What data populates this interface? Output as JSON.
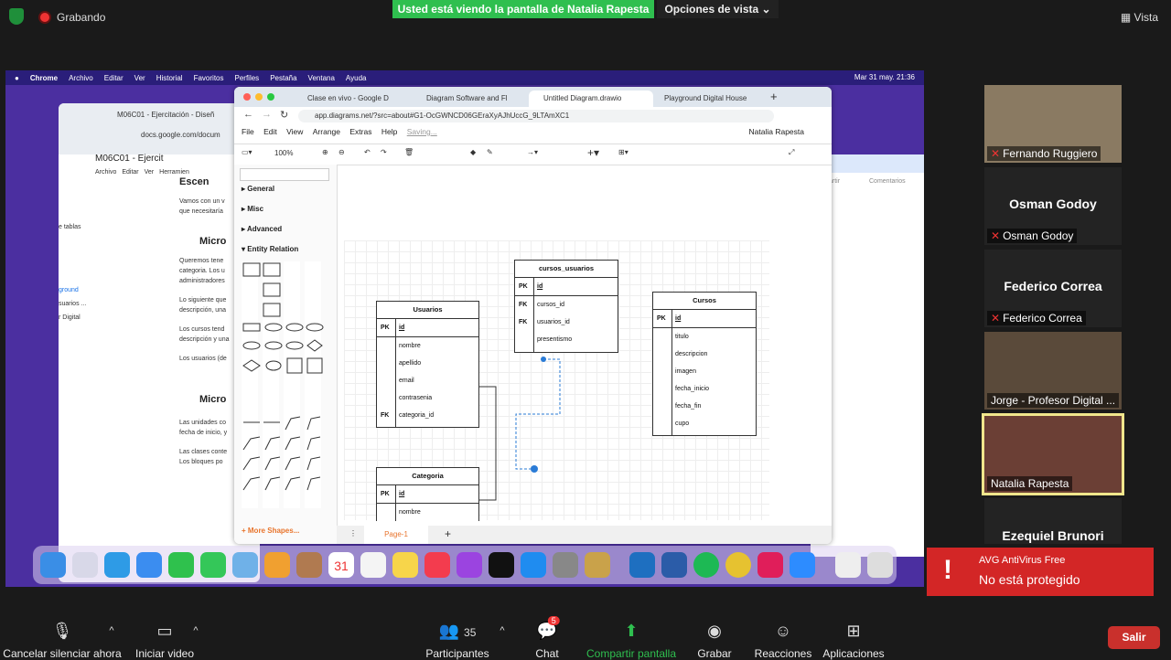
{
  "zoom": {
    "recording_label": "Grabando",
    "share_banner": "Usted está viendo la pantalla de Natalia Rapesta",
    "share_options": "Opciones de vista",
    "view_label": "Vista"
  },
  "mac": {
    "menu": [
      "Chrome",
      "Archivo",
      "Editar",
      "Ver",
      "Historial",
      "Favoritos",
      "Perfiles",
      "Pestaña",
      "Ventana",
      "Ayuda"
    ],
    "datetime": "Mar 31 may.  21:36"
  },
  "gdoc": {
    "tab_title": "M06C01 - Ejercitación - Diseñ",
    "url": "docs.google.com/docum",
    "doc_title": "M06C01 - Ejercit",
    "menu": [
      "Archivo",
      "Editar",
      "Ver",
      "Herramien"
    ],
    "heading": "Escen",
    "side_items": [
      "e tablas",
      "ground",
      "suarios ...",
      "r Digital"
    ],
    "paragraphs": [
      "Vamos con un v",
      "que necesitaría",
      "Micro",
      "Queremos tene",
      "categoria. Los u",
      "administradores",
      "Lo siguiente que",
      "descripción, una",
      "Los cursos tend",
      "descripción y una",
      "Los usuarios (de",
      "Micro",
      "Las unidades co",
      "fecha de inicio, y",
      "Las clases conte",
      "Los bloques po"
    ]
  },
  "drawio": {
    "tabs": [
      "Clase en vivo - Google D",
      "Diagram Software and Fl",
      "Untitled Diagram.drawio",
      "Playground Digital House"
    ],
    "url": "app.diagrams.net/?src=about#G1-OcGWNCD06GEraXyAJhUccG_9LTAmXC1",
    "menu": [
      "File",
      "Edit",
      "View",
      "Arrange",
      "Extras",
      "Help"
    ],
    "saving": "Saving...",
    "user": "Natalia Rapesta",
    "zoom": "100%",
    "sidebar_sections": [
      "General",
      "Misc",
      "Advanced",
      "Entity Relation"
    ],
    "more_shapes": "+ More Shapes...",
    "page_tab": "Page-1",
    "right_toolbar": [
      "artir",
      "Comentarios"
    ],
    "entities": {
      "usuarios": {
        "title": "Usuarios",
        "rows": [
          {
            "k": "PK",
            "f": "id"
          },
          {
            "k": "",
            "f": "nombre"
          },
          {
            "k": "",
            "f": "apellido"
          },
          {
            "k": "",
            "f": "email"
          },
          {
            "k": "",
            "f": "contrasenia"
          },
          {
            "k": "FK",
            "f": "categoria_id"
          }
        ]
      },
      "cursos_usuarios": {
        "title": "cursos_usuarios",
        "rows": [
          {
            "k": "PK",
            "f": "id"
          },
          {
            "k": "FK",
            "f": "cursos_id"
          },
          {
            "k": "FK",
            "f": "usuarios_id"
          },
          {
            "k": "",
            "f": "presentismo"
          }
        ]
      },
      "cursos": {
        "title": "Cursos",
        "rows": [
          {
            "k": "PK",
            "f": "id"
          },
          {
            "k": "",
            "f": "titulo"
          },
          {
            "k": "",
            "f": "descripcion"
          },
          {
            "k": "",
            "f": "imagen"
          },
          {
            "k": "",
            "f": "fecha_inicio"
          },
          {
            "k": "",
            "f": "fecha_fin"
          },
          {
            "k": "",
            "f": "cupo"
          }
        ]
      },
      "categoria": {
        "title": "Categoria",
        "rows": [
          {
            "k": "PK",
            "f": "id"
          },
          {
            "k": "",
            "f": "nombre"
          }
        ]
      }
    }
  },
  "participants": [
    {
      "name": "Fernando Ruggiero",
      "muted": true,
      "video": true
    },
    {
      "name": "Osman Godoy",
      "muted": true,
      "video": false
    },
    {
      "name": "Federico Correa",
      "muted": true,
      "video": false
    },
    {
      "name": "Jorge - Profesor Digital ...",
      "muted": false,
      "video": true
    },
    {
      "name": "Natalia Rapesta",
      "muted": false,
      "video": true,
      "active": true
    },
    {
      "name": "Ezequiel Brunori",
      "muted": false,
      "video": false
    }
  ],
  "avg": {
    "title": "AVG AntiVirus Free",
    "message": "No está protegido"
  },
  "controls": {
    "mute": "Cancelar silenciar ahora",
    "video": "Iniciar video",
    "participants": "Participantes",
    "participants_count": "35",
    "chat": "Chat",
    "chat_badge": "5",
    "share": "Compartir pantalla",
    "record": "Grabar",
    "reactions": "Reacciones",
    "apps": "Aplicaciones",
    "leave": "Salir"
  },
  "colors": {
    "share_green": "#2fbf4f",
    "active_border": "#f0e68c",
    "leave_red": "#c9302c",
    "avg_red": "#d32626"
  }
}
